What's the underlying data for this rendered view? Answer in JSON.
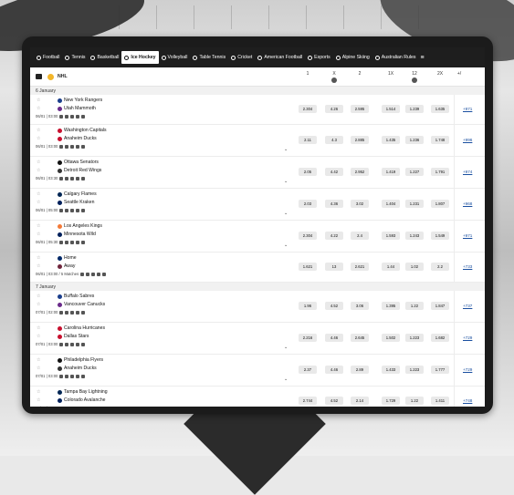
{
  "nav": {
    "items": [
      {
        "label": "Football",
        "icon": "football-icon"
      },
      {
        "label": "Tennis",
        "icon": "tennis-icon"
      },
      {
        "label": "Basketball",
        "icon": "basketball-icon"
      },
      {
        "label": "Ice Hockey",
        "icon": "hockey-icon",
        "active": true
      },
      {
        "label": "Volleyball",
        "icon": "volleyball-icon"
      },
      {
        "label": "Table Tennis",
        "icon": "table-tennis-icon"
      },
      {
        "label": "Cricket",
        "icon": "cricket-icon"
      },
      {
        "label": "American Football",
        "icon": "american-football-icon"
      },
      {
        "label": "Esports",
        "icon": "esports-icon"
      },
      {
        "label": "Alpine Skiing",
        "icon": "skiing-icon"
      },
      {
        "label": "Australian Rules",
        "icon": "aussie-rules-icon"
      }
    ],
    "more_icon": "menu-icon"
  },
  "league": {
    "name": "NHL"
  },
  "columns": [
    "1",
    "X",
    "2",
    "1X",
    "12",
    "2X",
    "+/"
  ],
  "days": [
    {
      "label": "6 January",
      "matches": [
        {
          "home": "New York Rangers",
          "away": "Utah Mammoth",
          "time": "06/01 | 03:00",
          "odds": [
            "2.304",
            "4.26",
            "2.595",
            "1.514",
            "1.239",
            "1.635"
          ],
          "more": "+971",
          "chevron": false
        },
        {
          "home": "Washington Capitals",
          "away": "Anaheim Ducks",
          "time": "06/01 | 03:00",
          "odds": [
            "2.11",
            "4.3",
            "2.885",
            "1.435",
            "1.236",
            "1.748"
          ],
          "more": "+996",
          "chevron": true
        },
        {
          "home": "Ottawa Senators",
          "away": "Detroit Red Wings",
          "time": "06/01 | 03:30",
          "odds": [
            "2.05",
            "4.42",
            "2.952",
            "1.419",
            "1.227",
            "1.791"
          ],
          "more": "+974",
          "chevron": true
        },
        {
          "home": "Calgary Flames",
          "away": "Seattle Kraken",
          "time": "06/01 | 05:00",
          "odds": [
            "2.03",
            "4.36",
            "3.02",
            "1.404",
            "1.231",
            "1.807"
          ],
          "more": "+968",
          "chevron": true
        },
        {
          "home": "Los Angeles Kings",
          "away": "Minnesota Wild",
          "time": "06/01 | 05:30",
          "odds": [
            "2.304",
            "4.22",
            "2.4",
            "1.593",
            "1.243",
            "1.549"
          ],
          "more": "+971",
          "chevron": true
        },
        {
          "home": "Home",
          "away": "Away",
          "time": "06/01 | 03:00 / 5 Matches",
          "odds": [
            "1.621",
            "13",
            "2.621",
            "1.44",
            "1.02",
            "2.2"
          ],
          "more": "+733",
          "chevron": false
        }
      ]
    },
    {
      "label": "7 January",
      "matches": [
        {
          "home": "Buffalo Sabres",
          "away": "Vancouver Canucks",
          "time": "07/01 | 02:00",
          "odds": [
            "1.96",
            "4.52",
            "3.06",
            "1.395",
            "1.22",
            "1.847"
          ],
          "more": "+737",
          "chevron": false
        },
        {
          "home": "Carolina Hurricanes",
          "away": "Dallas Stars",
          "time": "07/01 | 03:00",
          "odds": [
            "2.216",
            "4.46",
            "2.645",
            "1.502",
            "1.223",
            "1.682"
          ],
          "more": "+729",
          "chevron": true
        },
        {
          "home": "Philadelphia Flyers",
          "away": "Anaheim Ducks",
          "time": "07/01 | 03:00",
          "odds": [
            "2.37",
            "4.46",
            "2.89",
            "1.433",
            "1.223",
            "1.777"
          ],
          "more": "+729",
          "chevron": true
        },
        {
          "home": "Tampa Bay Lightning",
          "away": "Colorado Avalanche",
          "time": "07/01 | 03:00",
          "odds": [
            "2.744",
            "4.52",
            "2.14",
            "1.729",
            "1.22",
            "1.411"
          ],
          "more": "+748",
          "chevron": true
        }
      ]
    }
  ],
  "colors": {
    "nav_bg": "#1e1e1e",
    "odds_bg": "#e9e9e9",
    "link": "#1a4fa0"
  }
}
